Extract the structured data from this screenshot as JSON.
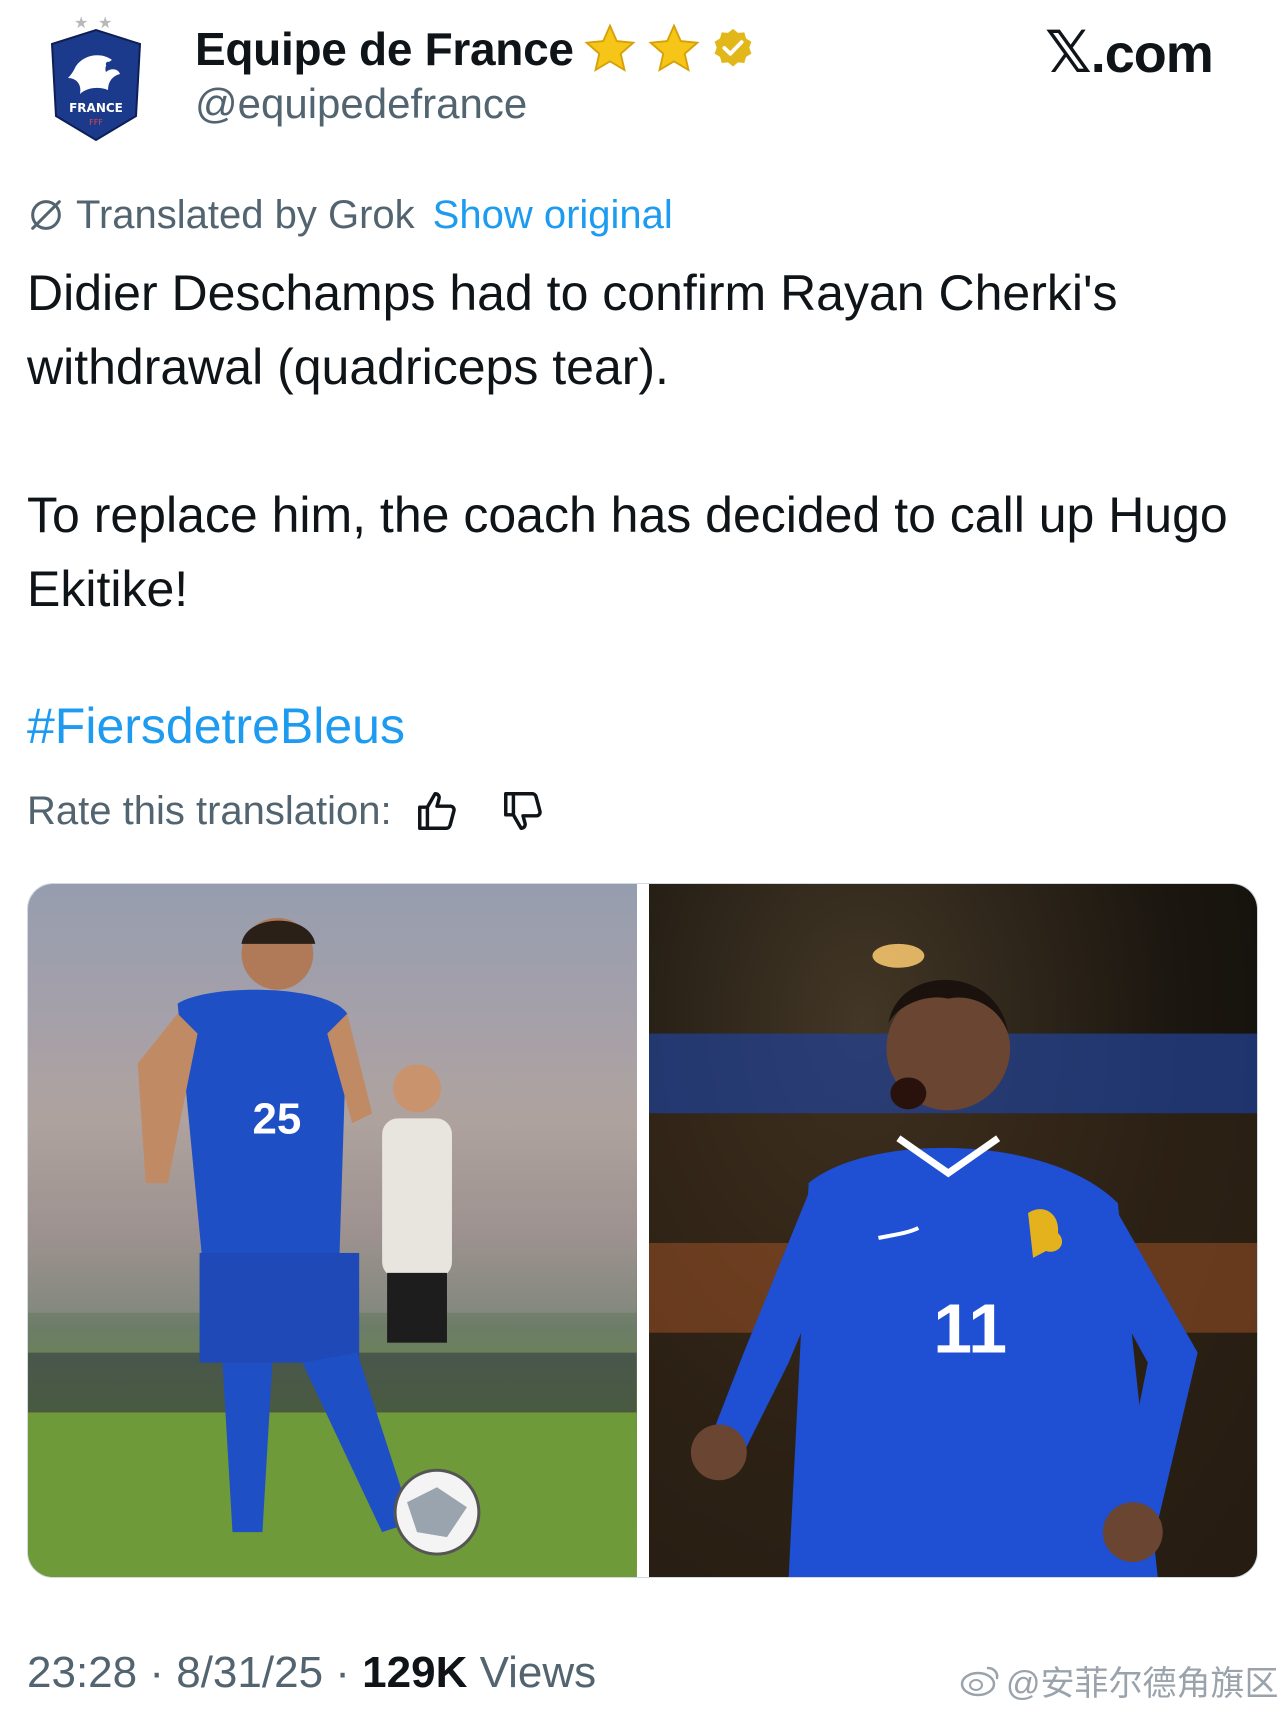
{
  "author": {
    "display_name": "Equipe de France",
    "handle": "@equipedefrance",
    "badges": [
      "star-icon",
      "star-icon",
      "verified-badge-icon"
    ],
    "avatar_text": "FRANCE",
    "avatar_subtext": "FFF"
  },
  "brand": {
    "label": ".com",
    "mark": "𝕏"
  },
  "translation": {
    "label": "Translated by Grok",
    "show_original": "Show original"
  },
  "tweet": {
    "paragraphs": [
      "Didier Deschamps had to confirm Rayan Cherki's withdrawal (quadriceps tear).",
      "To replace him, the coach has decided to call up Hugo Ekitike!"
    ],
    "hashtag": "#FiersdetreBleus"
  },
  "rate": {
    "label": "Rate this translation:"
  },
  "media": {
    "photos": [
      {
        "name": "photo-player-25",
        "jersey_number": "25"
      },
      {
        "name": "photo-player-11",
        "jersey_number": "11"
      }
    ]
  },
  "meta": {
    "time": "23:28",
    "date": "8/31/25",
    "separator": "·",
    "views_count": "129K",
    "views_label": "Views"
  },
  "watermark": {
    "text": "@安菲尔德角旗区"
  },
  "colors": {
    "accent": "#1d9bf0",
    "secondary_text": "#536471",
    "primary_text": "#0f1419",
    "star": "#f5c518",
    "verified_gold": "#e2b719",
    "france_blue": "#1c3a8c"
  }
}
